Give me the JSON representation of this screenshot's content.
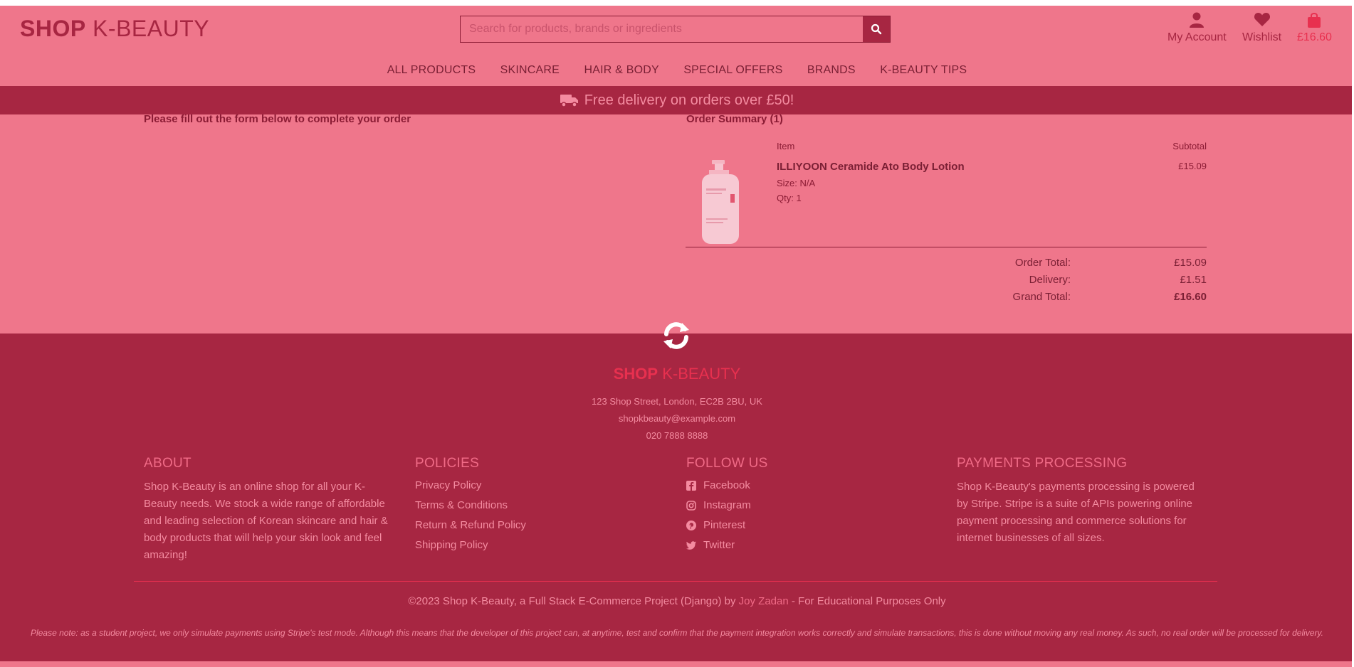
{
  "header": {
    "logo_bold": "SHOP",
    "logo_rest": " K-BEAUTY",
    "search_placeholder": "Search for products, brands or ingredients",
    "account_label": "My Account",
    "wishlist_label": "Wishlist",
    "cart_total": "£16.60"
  },
  "nav": [
    "ALL PRODUCTS",
    "SKINCARE",
    "HAIR & BODY",
    "SPECIAL OFFERS",
    "BRANDS",
    "K-BEAUTY TIPS"
  ],
  "banner": {
    "text": "Free delivery on orders over £50!"
  },
  "checkout": {
    "form_note": "Please fill out the form below to complete your order",
    "summary_title": "Order Summary (1)",
    "col_item": "Item",
    "col_subtotal": "Subtotal",
    "product": {
      "name": "ILLIYOON Ceramide Ato Body Lotion",
      "size": "Size: N/A",
      "qty": "Qty: 1",
      "price": "£15.09"
    },
    "totals": {
      "order_label": "Order Total:",
      "order_value": "£15.09",
      "delivery_label": "Delivery:",
      "delivery_value": "£1.51",
      "grand_label": "Grand Total:",
      "grand_value": "£16.60"
    }
  },
  "footer": {
    "logo_bold": "SHOP",
    "logo_rest": " K-BEAUTY",
    "address": "123 Shop Street, London, EC2B 2BU, UK",
    "email": "shopkbeauty@example.com",
    "phone": "020 7888 8888",
    "about": {
      "title": "ABOUT",
      "text": "Shop K-Beauty is an online shop for all your K-Beauty needs. We stock a wide range of affordable and leading selection of Korean skincare and hair & body products that will help your skin look and feel amazing!"
    },
    "policies": {
      "title": "POLICIES",
      "links": [
        "Privacy Policy",
        "Terms & Conditions",
        "Return & Refund Policy",
        "Shipping Policy"
      ]
    },
    "follow": {
      "title": "FOLLOW US",
      "links": [
        "Facebook",
        "Instagram",
        "Pinterest",
        "Twitter"
      ]
    },
    "payments": {
      "title": "PAYMENTS PROCESSING",
      "text": "Shop K-Beauty's payments processing is powered by Stripe. Stripe is a suite of APIs powering online payment processing and commerce solutions for internet businesses of all sizes."
    },
    "copyright_pre": "©2023 Shop K-Beauty, a Full Stack E-Commerce Project (Django) by ",
    "copyright_author": "Joy Zadan",
    "copyright_post": " - For Educational Purposes Only",
    "note": "Please note: as a student project, we only simulate payments using Stripe's test mode. Although this means that the developer of this project can, at anytime, test and confirm that the payment integration works correctly and simulate transactions, this is done without moving any real money. As such, no real order will be processed for delivery."
  }
}
